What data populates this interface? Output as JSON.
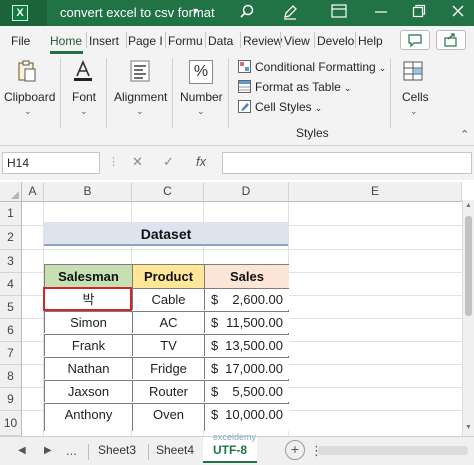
{
  "window": {
    "title": "convert excel to csv format",
    "app_icon": "X"
  },
  "ribbon_tabs": [
    "File",
    "Home",
    "Insert",
    "Page I",
    "Formu",
    "Data",
    "Review",
    "View",
    "Develo",
    "Help"
  ],
  "active_tab": "Home",
  "ribbon": {
    "clipboard_label": "Clipboard",
    "font_label": "Font",
    "alignment_label": "Alignment",
    "number_label": "Number",
    "percent_glyph": "%",
    "conditional_formatting": "Conditional Formatting",
    "format_as_table": "Format as Table",
    "cell_styles": "Cell Styles",
    "styles_group_label": "Styles",
    "cells_label": "Cells"
  },
  "formula_bar": {
    "name_box": "H14",
    "cancel_glyph": "✕",
    "enter_glyph": "✓",
    "fx_glyph": "fx",
    "formula": ""
  },
  "columns": [
    "A",
    "B",
    "C",
    "D",
    "E"
  ],
  "rows": [
    "1",
    "2",
    "3",
    "4",
    "5",
    "6",
    "7",
    "8",
    "9",
    "10"
  ],
  "dataset_title": "Dataset",
  "table": {
    "headers": [
      "Salesman",
      "Product",
      "Sales"
    ],
    "header_colors": [
      "#c6e0b4",
      "#ffe699",
      "#fce4d6"
    ],
    "rows": [
      {
        "salesman": "박",
        "product": "Cable",
        "currency": "$",
        "amount": "2,600.00"
      },
      {
        "salesman": "Simon",
        "product": "AC",
        "currency": "$",
        "amount": "11,500.00"
      },
      {
        "salesman": "Frank",
        "product": "TV",
        "currency": "$",
        "amount": "13,500.00"
      },
      {
        "salesman": "Nathan",
        "product": "Fridge",
        "currency": "$",
        "amount": "17,000.00"
      },
      {
        "salesman": "Jaxson",
        "product": "Router",
        "currency": "$",
        "amount": "5,500.00"
      },
      {
        "salesman": "Anthony",
        "product": "Oven",
        "currency": "$",
        "amount": "10,000.00"
      }
    ]
  },
  "sheet_tabs": {
    "ellipsis": "...",
    "tabs": [
      "Sheet3",
      "Sheet4",
      "UTF-8"
    ],
    "active": "UTF-8",
    "add_glyph": "+"
  },
  "watermark": "exceldemy",
  "accent_color": "#217346",
  "selection_color": "#d0262a"
}
